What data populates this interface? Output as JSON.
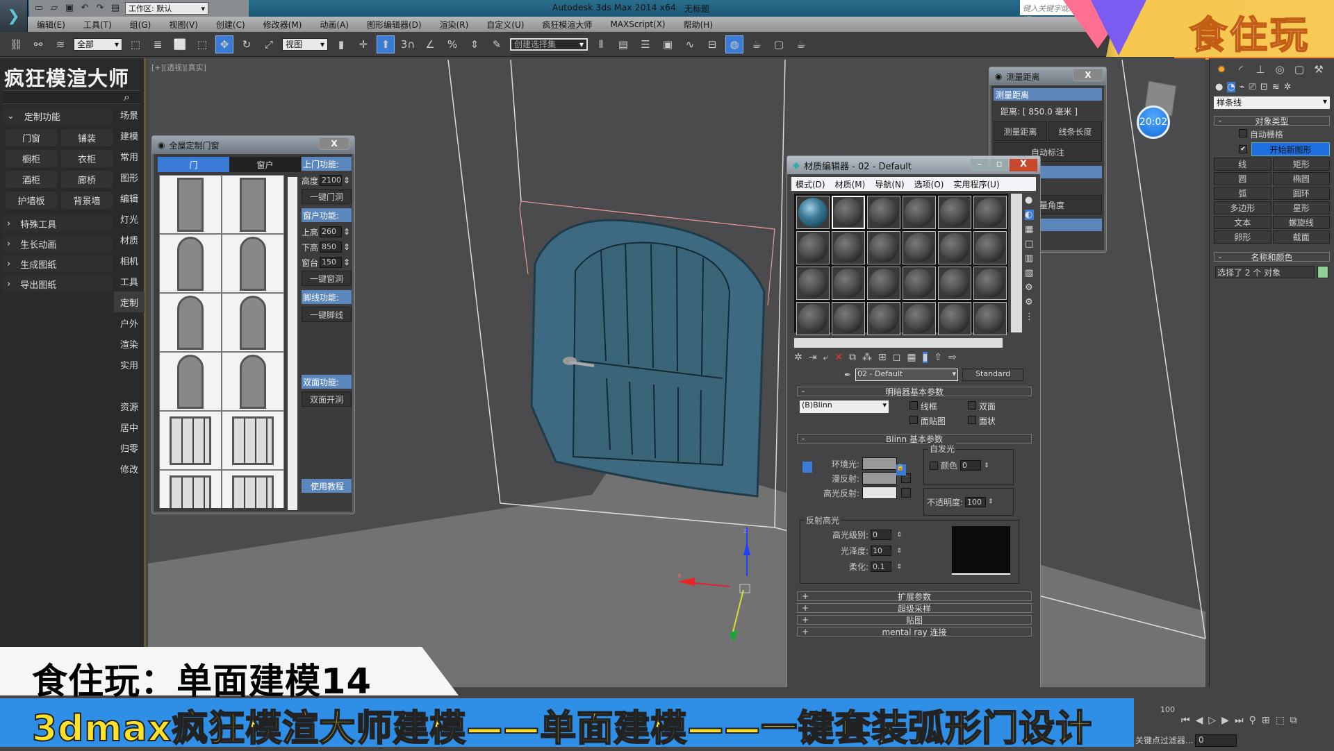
{
  "app": {
    "title": "Autodesk 3ds Max  2014 x64",
    "document": "无标题",
    "workspace_label": "工作区: 默认",
    "search_placeholder": "键入关键字或短语"
  },
  "menu": [
    "编辑(E)",
    "工具(T)",
    "组(G)",
    "视图(V)",
    "创建(C)",
    "修改器(M)",
    "动画(A)",
    "图形编辑器(D)",
    "渲染(R)",
    "自定义(U)",
    "疯狂模渲大师",
    "MAXScript(X)",
    "帮助(H)"
  ],
  "toolbar": {
    "selection_filter": "全部",
    "ref_coord": "视图",
    "named_selection": "创建选择集",
    "snap_label": "3"
  },
  "brand": {
    "text": "食住玩"
  },
  "viewport": {
    "label": "[+][透视][真实]",
    "gizmo_x": "x",
    "gizmo_z": "z"
  },
  "left_panel": {
    "title": "疯狂模渲大师",
    "sections": [
      {
        "label": "定制功能",
        "expanded": true
      },
      {
        "label": "特殊工具",
        "expanded": false
      },
      {
        "label": "生长动画",
        "expanded": false
      },
      {
        "label": "生成图纸",
        "expanded": false
      },
      {
        "label": "导出图纸",
        "expanded": false
      }
    ],
    "buttons": [
      "门窗",
      "铺装",
      "橱柜",
      "衣柜",
      "酒柜",
      "廊桥",
      "护墙板",
      "背景墙"
    ],
    "tabs": [
      "场景",
      "建模",
      "常用",
      "图形",
      "编辑",
      "灯光",
      "材质",
      "相机",
      "工具",
      "定制",
      "户外",
      "渲染",
      "实用",
      "",
      "资源",
      "居中",
      "归零",
      "修改"
    ],
    "active_tab": "定制"
  },
  "door_window": {
    "title": "全屋定制门窗",
    "close": "X",
    "tabs": [
      "门",
      "窗户"
    ],
    "active_tab": "门",
    "door_section": "上门功能:",
    "height_label": "高度",
    "height_value": "2100",
    "door_hole_btn": "一键门洞",
    "window_section": "窗户功能:",
    "upper_label": "上高",
    "upper_value": "260",
    "lower_label": "下高",
    "lower_value": "850",
    "sill_label": "窗台",
    "sill_value": "150",
    "window_hole_btn": "一键窗洞",
    "baseboard_section": "脚线功能:",
    "baseboard_btn": "一键脚线",
    "double_section": "双面功能:",
    "double_btn": "双面开洞",
    "tutorial": "使用教程",
    "gallery": [
      "rect-door",
      "rect-door",
      "arch-door",
      "arch-door",
      "arch-door",
      "arch-door",
      "arch-door",
      "arch-door",
      "window",
      "window",
      "window",
      "window"
    ]
  },
  "measure_window": {
    "title": "测量距离",
    "close": "X",
    "header": "测量距离",
    "distance": "距离: [ 850.0 毫米 ]",
    "btn_measure": "测量距离",
    "btn_line": "线条长度",
    "btn_auto": "自动标注",
    "btn_angle": "测量角度"
  },
  "material_editor": {
    "title": "材质编辑器 - 02 - Default",
    "menu": [
      "模式(D)",
      "材质(M)",
      "导航(N)",
      "选项(O)",
      "实用程序(U)"
    ],
    "material_name": "02 - Default",
    "material_type": "Standard",
    "shader_rollout": "明暗器基本参数",
    "shader": "(B)Blinn",
    "checks": [
      "线框",
      "双面",
      "面贴图",
      "面状"
    ],
    "blinn_rollout": "Blinn 基本参数",
    "self_illum": "自发光",
    "color_label": "颜色",
    "color_value": "0",
    "ambient": "环境光:",
    "diffuse": "漫反射:",
    "specular": "高光反射:",
    "opacity_label": "不透明度:",
    "opacity_value": "100",
    "spec_group": "反射高光",
    "spec_level_label": "高光级别:",
    "spec_level": "0",
    "gloss_label": "光泽度:",
    "gloss": "10",
    "soften_label": "柔化:",
    "soften": "0.1",
    "rollouts": [
      "扩展参数",
      "超级采样",
      "贴图",
      "mental ray 连接"
    ],
    "slot_count": 24,
    "active_slot": 0
  },
  "command_panel": {
    "category": "样条线",
    "object_type": "对象类型",
    "autogrid": "自动栅格",
    "start_new_shape": "开始新图形",
    "start_new_checked": true,
    "buttons": [
      "线",
      "矩形",
      "圆",
      "椭圆",
      "弧",
      "圆环",
      "多边形",
      "星形",
      "文本",
      "螺旋线",
      "卵形",
      "截面"
    ],
    "name_color": "名称和颜色",
    "selection_text": "选择了 2 个 对象",
    "object_color": "#8fcf8f"
  },
  "clock": "20:02",
  "timeline": {
    "tick": "100",
    "frame": "0",
    "filter": "关键点过滤器..."
  },
  "captions": {
    "line1": "食住玩：单面建模14",
    "line2": "3dmax疯狂模渲大师建模——单面建模——一键套装弧形门设计"
  }
}
